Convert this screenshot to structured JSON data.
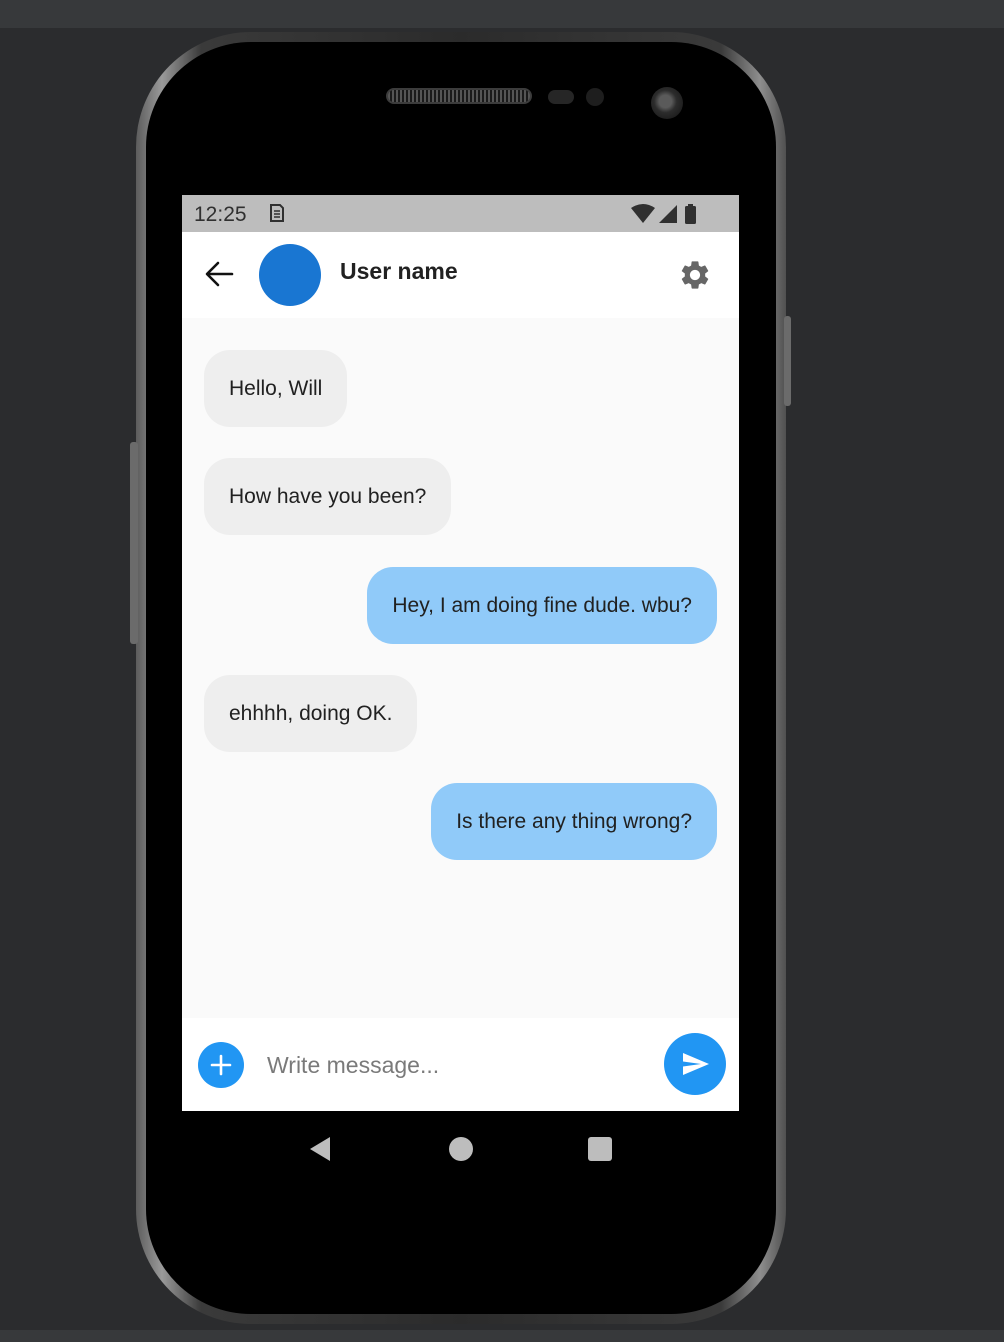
{
  "status_bar": {
    "time": "12:25"
  },
  "app_bar": {
    "user_name": "User name",
    "avatar_color": "#1976d2"
  },
  "messages": [
    {
      "text": "Hello, Will",
      "direction": "incoming"
    },
    {
      "text": "How have you been?",
      "direction": "incoming"
    },
    {
      "text": "Hey, I am doing fine dude. wbu?",
      "direction": "outgoing"
    },
    {
      "text": "ehhhh, doing OK.",
      "direction": "incoming"
    },
    {
      "text": "Is there any thing wrong?",
      "direction": "outgoing"
    }
  ],
  "composer": {
    "placeholder": "Write message...",
    "value": ""
  },
  "colors": {
    "accent": "#2196f3",
    "incoming_bubble": "#eeeeee",
    "outgoing_bubble": "#90caf9"
  },
  "icons": {
    "back": "arrow-back-icon",
    "settings": "gear-icon",
    "add": "plus-icon",
    "send": "send-icon",
    "wifi": "wifi-icon",
    "signal": "signal-icon",
    "battery": "battery-icon",
    "sim": "sim-card-icon"
  }
}
